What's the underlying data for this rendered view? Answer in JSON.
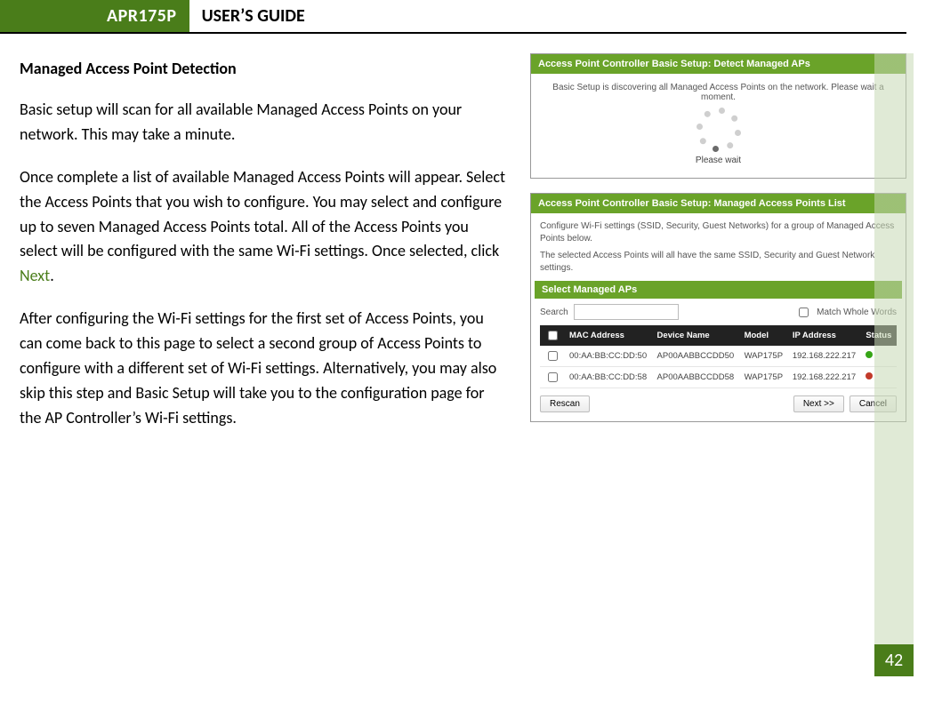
{
  "header": {
    "badge": "APR175P",
    "title": "USER’S GUIDE"
  },
  "page_number": "42",
  "section_heading": "Managed Access Point Detection",
  "paragraphs": {
    "p1": "Basic setup will scan for all available Managed Access Points on your network. This may take a minute.",
    "p2a": "Once complete a list of available Managed Access Points will appear.  Select the Access Points that you wish to configure.  You may select and configure up to seven Managed Access Points total.  All of the Access Points you select will be configured with the same Wi-Fi settings.  Once selected, click ",
    "p2_next": "Next",
    "p2b": ".",
    "p3": "After configuring the Wi-Fi settings for the first set of Access Points, you can come back to this page to select a second group of Access Points to configure with a different set of Wi-Fi settings.  Alternatively, you may also skip this step and Basic Setup will take you to the configuration page for the AP Controller’s Wi-Fi settings."
  },
  "card1": {
    "title": "Access Point Controller Basic Setup: Detect Managed APs",
    "body_text": "Basic Setup is discovering all Managed Access Points on the network. Please wait a moment.",
    "please_wait": "Please wait"
  },
  "card2": {
    "title": "Access Point Controller Basic Setup: Managed Access Points List",
    "desc1": "Configure Wi-Fi settings (SSID, Security, Guest Networks) for a group of Managed Access Points below.",
    "desc2": "The selected Access Points will all have the same SSID, Security and Guest Network settings.",
    "subtitle": "Select Managed APs",
    "search_label": "Search",
    "search_value": "",
    "match_label": "Match Whole Words",
    "columns": {
      "mac": "MAC Address",
      "name": "Device Name",
      "model": "Model",
      "ip": "IP Address",
      "status": "Status"
    },
    "rows": [
      {
        "mac": "00:AA:BB:CC:DD:50",
        "name": "AP00AABBCCDD50",
        "model": "WAP175P",
        "ip": "192.168.222.217",
        "status": "green"
      },
      {
        "mac": "00:AA:BB:CC:DD:58",
        "name": "AP00AABBCCDD58",
        "model": "WAP175P",
        "ip": "192.168.222.217",
        "status": "red"
      }
    ],
    "buttons": {
      "rescan": "Rescan",
      "next": "Next >>",
      "cancel": "Cancel"
    }
  }
}
